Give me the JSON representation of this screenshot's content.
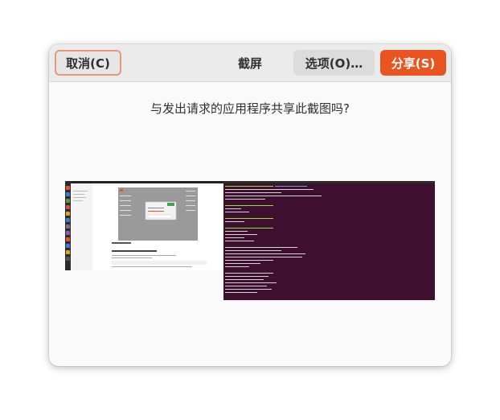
{
  "header": {
    "cancel_label": "取消(C)",
    "title": "截屏",
    "options_label": "选项(O)…",
    "share_label": "分享(S)"
  },
  "body": {
    "question": "与发出请求的应用程序共享此截图吗?"
  },
  "preview": {
    "left_panel_heading": "二、截图教程",
    "left_panel_subheading": "01. 本机截图 Screenshot 屏幕截图"
  },
  "colors": {
    "accent": "#e95420",
    "terminal_bg": "#3e0f2f",
    "cancel_border": "#e39a7c"
  }
}
